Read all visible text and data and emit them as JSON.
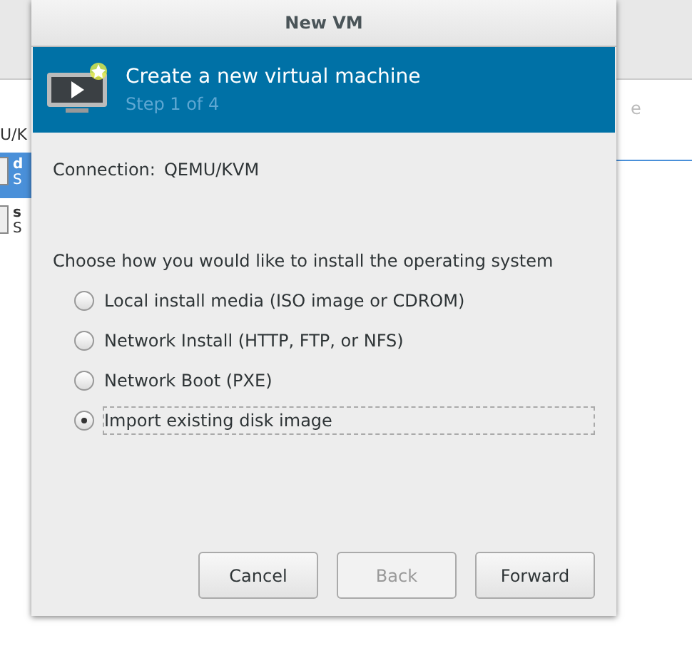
{
  "background_window": {
    "path_fragment": "U/K",
    "column_fragment": "e",
    "rows": [
      {
        "name": "d",
        "status": "S",
        "selected": true
      },
      {
        "name": "s",
        "status": "S",
        "selected": false
      }
    ]
  },
  "dialog": {
    "title": "New VM",
    "header": {
      "title": "Create a new virtual machine",
      "step": "Step 1 of 4"
    },
    "connection_label": "Connection:",
    "connection_value": "QEMU/KVM",
    "prompt": "Choose how you would like to install the operating system",
    "options": [
      {
        "label": "Local install media (ISO image or CDROM)",
        "selected": false
      },
      {
        "label": "Network Install (HTTP, FTP, or NFS)",
        "selected": false
      },
      {
        "label": "Network Boot (PXE)",
        "selected": false
      },
      {
        "label": "Import existing disk image",
        "selected": true
      }
    ],
    "buttons": [
      {
        "label": "Cancel",
        "disabled": false
      },
      {
        "label": "Back",
        "disabled": true
      },
      {
        "label": "Forward",
        "disabled": false
      }
    ]
  }
}
